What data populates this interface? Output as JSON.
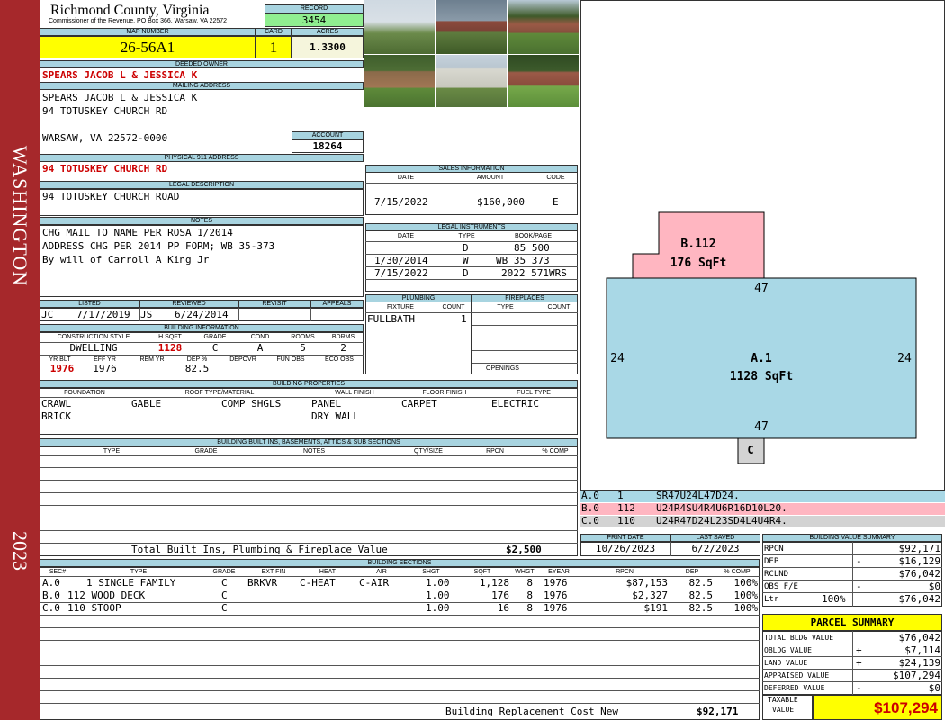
{
  "side": {
    "label": "WASHINGTON",
    "year": "2023"
  },
  "header": {
    "county": "Richmond County, Virginia",
    "commissioner": "Commissioner of the Revenue, PO Box 366, Warsaw, VA 22572",
    "record_label": "RECORD",
    "record": "3454",
    "map_label": "MAP NUMBER",
    "map": "26-56A1",
    "card_label": "CARD",
    "card": "1",
    "acres_label": "ACRES",
    "acres": "1.3300"
  },
  "owner": {
    "deeded_label": "DEEDED OWNER",
    "deeded": "SPEARS JACOB L & JESSICA K",
    "mailing_label": "MAILING ADDRESS",
    "mailing_line1": "SPEARS JACOB L & JESSICA K",
    "mailing_line2": "94 TOTUSKEY CHURCH RD",
    "mailing_line3": "WARSAW, VA 22572-0000",
    "account_label": "ACCOUNT",
    "account": "18264",
    "physical_label": "PHYSICAL 911 ADDRESS",
    "physical": "94 TOTUSKEY CHURCH RD",
    "legal_label": "LEGAL DESCRIPTION",
    "legal": "94 TOTUSKEY CHURCH ROAD",
    "notes_label": "NOTES",
    "notes": [
      "CHG MAIL TO NAME PER ROSA 1/2014",
      "ADDRESS CHG PER 2014 PP FORM; WB 35-373",
      "By will of Carroll A King Jr"
    ]
  },
  "sales": {
    "title": "SALES INFORMATION",
    "h_date": "DATE",
    "h_amount": "AMOUNT",
    "h_code": "CODE",
    "date": "7/15/2022",
    "amount": "$160,000",
    "code": "E"
  },
  "legal_instruments": {
    "title": "LEGAL INSTRUMENTS",
    "h_date": "DATE",
    "h_type": "TYPE",
    "h_book": "BOOK/PAGE",
    "rows": [
      {
        "date": "",
        "type": "D",
        "book": "85 500"
      },
      {
        "date": "1/30/2014",
        "type": "W",
        "book": "WB 35 373"
      },
      {
        "date": "7/15/2022",
        "type": "D",
        "book": "2022 571WRS"
      }
    ]
  },
  "review": {
    "listed_label": "LISTED",
    "listed_by": "JC",
    "listed_date": "7/17/2019",
    "reviewed_label": "REVIEWED",
    "reviewed_by": "JS",
    "reviewed_date": "6/24/2014",
    "revisit_label": "REVISIT",
    "appeals_label": "APPEALS"
  },
  "building_info": {
    "title": "BUILDING INFORMATION",
    "h_style": "CONSTRUCTION STYLE",
    "h_hsqft": "H SQFT",
    "h_grade": "GRADE",
    "h_cond": "COND",
    "h_rooms": "ROOMS",
    "h_bdrms": "BDRMS",
    "style": "DWELLING",
    "hsqft": "1128",
    "grade": "C",
    "cond": "A",
    "rooms": "5",
    "bdrms": "2",
    "h_yrblt": "YR BLT",
    "h_effyr": "EFF YR",
    "h_remyr": "REM YR",
    "h_dep": "DEP %",
    "h_depovr": "DEPOVR",
    "h_funobs": "FUN OBS",
    "h_ecoobs": "ECO OBS",
    "yrblt": "1976",
    "effyr": "1976",
    "dep": "82.5"
  },
  "plumbing": {
    "title": "PLUMBING",
    "h_fixture": "FIXTURE",
    "h_count": "COUNT",
    "fixture": "FULLBATH",
    "count": "1"
  },
  "fireplaces": {
    "title": "FIREPLACES",
    "h_type": "TYPE",
    "h_count": "COUNT",
    "openings_label": "OPENINGS"
  },
  "properties": {
    "title": "BUILDING PROPERTIES",
    "h_foundation": "FOUNDATION",
    "h_roof": "ROOF TYPE/MATERIAL",
    "h_wall": "WALL FINISH",
    "h_floor": "FLOOR FINISH",
    "h_fuel": "FUEL TYPE",
    "foundation1": "CRAWL",
    "foundation2": "BRICK",
    "roof1": "GABLE",
    "roof2": "COMP SHGLS",
    "wall1": "PANEL",
    "wall2": "DRY WALL",
    "floor1": "CARPET",
    "fuel1": "ELECTRIC"
  },
  "builtins": {
    "title": "BUILDING BUILT INS, BASEMENTS, ATTICS & SUB SECTIONS",
    "h_type": "TYPE",
    "h_grade": "GRADE",
    "h_notes": "NOTES",
    "h_qty": "QTY/SIZE",
    "h_rpcn": "RPCN",
    "h_comp": "% COMP",
    "total_label": "Total Built Ins, Plumbing & Fireplace Value",
    "total": "$2,500"
  },
  "sketch": {
    "b_label": "B.112",
    "b_area": "176 SqFt",
    "a_label": "A.1",
    "a_area": "1128 SqFt",
    "dim_top": "47",
    "dim_bottom": "47",
    "dim_left": "24",
    "dim_right": "24",
    "c_label": "C",
    "legend": [
      {
        "id": "A.0",
        "code": "1",
        "vectors": "SR47U24L47D24.",
        "color": "#a9d8e6"
      },
      {
        "id": "B.0",
        "code": "112",
        "vectors": "U24R4SU4R4U6R16D10L20.",
        "color": "#ffb6c1"
      },
      {
        "id": "C.0",
        "code": "110",
        "vectors": "U24R47D24L23SD4L4U4R4.",
        "color": "#d3d3d3"
      }
    ]
  },
  "dates": {
    "print_label": "PRINT DATE",
    "print": "10/26/2023",
    "saved_label": "LAST SAVED",
    "saved": "6/2/2023"
  },
  "sections": {
    "title": "BUILDING SECTIONS",
    "h_sec": "SEC#",
    "h_type": "TYPE",
    "h_grade": "GRADE",
    "h_extfin": "EXT FIN",
    "h_heat": "HEAT",
    "h_air": "AIR",
    "h_shgt": "SHGT",
    "h_sqft": "SQFT",
    "h_whgt": "WHGT",
    "h_eyear": "EYEAR",
    "h_rpcn": "RPCN",
    "h_dep": "DEP",
    "h_comp": "% COMP",
    "rows": [
      {
        "sec": "A.0",
        "type": "1 SINGLE FAMILY",
        "grade": "C",
        "extfin": "BRKVR",
        "heat": "C-HEAT",
        "air": "C-AIR",
        "shgt": "1.00",
        "sqft": "1,128",
        "whgt": "8",
        "eyear": "1976",
        "rpcn": "$87,153",
        "dep": "82.5",
        "comp": "100%"
      },
      {
        "sec": "B.0",
        "type": "112 WOOD DECK",
        "grade": "C",
        "extfin": "",
        "heat": "",
        "air": "",
        "shgt": "1.00",
        "sqft": "176",
        "whgt": "8",
        "eyear": "1976",
        "rpcn": "$2,327",
        "dep": "82.5",
        "comp": "100%"
      },
      {
        "sec": "C.0",
        "type": "110 STOOP",
        "grade": "C",
        "extfin": "",
        "heat": "",
        "air": "",
        "shgt": "1.00",
        "sqft": "16",
        "whgt": "8",
        "eyear": "1976",
        "rpcn": "$191",
        "dep": "82.5",
        "comp": "100%"
      }
    ],
    "replacement_label": "Building Replacement Cost New",
    "replacement": "$92,171"
  },
  "value_summary": {
    "title": "BUILDING VALUE SUMMARY",
    "rows": [
      {
        "label": "RPCN",
        "sign": "",
        "value": "$92,171"
      },
      {
        "label": "DEP",
        "sign": "-",
        "value": "$16,129"
      },
      {
        "label": "RCLND",
        "sign": "",
        "value": "$76,042"
      },
      {
        "label": "OBS F/E",
        "sign": "-",
        "value": "$0"
      },
      {
        "label": "Ltr",
        "pct": "100%",
        "sign": "",
        "value": "$76,042"
      }
    ]
  },
  "parcel": {
    "title": "PARCEL SUMMARY",
    "rows": [
      {
        "label": "TOTAL BLDG VALUE",
        "sign": "",
        "value": "$76,042"
      },
      {
        "label": "OBLDG VALUE",
        "sign": "+",
        "value": "$7,114"
      },
      {
        "label": "LAND VALUE",
        "sign": "+",
        "value": "$24,139"
      },
      {
        "label": "APPRAISED VALUE",
        "sign": "",
        "value": "$107,294"
      },
      {
        "label": "DEFERRED VALUE",
        "sign": "-",
        "value": "$0"
      }
    ],
    "taxable_label1": "TAXABLE",
    "taxable_label2": "VALUE",
    "taxable": "$107,294"
  },
  "colors": {
    "band": "#a6282b",
    "label_bg": "#a8d4e0",
    "yellow": "#ffff00",
    "green": "#90ee90"
  }
}
